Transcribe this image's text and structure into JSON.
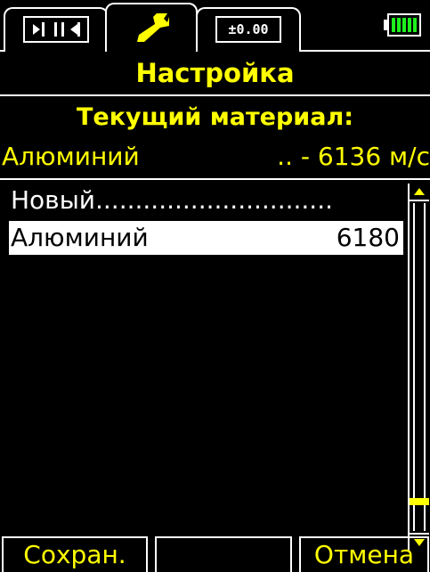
{
  "tabs": [
    {
      "icon": "thickness-gauge-icon",
      "label": "▸││◂"
    },
    {
      "icon": "wrench-icon",
      "label": ""
    },
    {
      "icon": "zero-offset-icon",
      "label": "±0.00"
    }
  ],
  "battery": {
    "level": 1.0,
    "color": "#1ef01e"
  },
  "header": {
    "title": "Настройка"
  },
  "material": {
    "heading": "Текущий материал:",
    "name": "Алюминий",
    "speed": ".. - 6136 м/с"
  },
  "list": {
    "items": [
      {
        "name": "Новый..............................",
        "value": ""
      },
      {
        "name": "Алюминий",
        "value": "6180"
      }
    ],
    "selected_index": 1
  },
  "scrollbar": {
    "position": 0.92,
    "thumb_color": "#ffff00"
  },
  "softkeys": {
    "left": "Сохран.",
    "middle": "",
    "right": "Отмена"
  },
  "colors": {
    "accent": "#ffff00",
    "background": "#000000",
    "foreground": "#ffffff"
  }
}
